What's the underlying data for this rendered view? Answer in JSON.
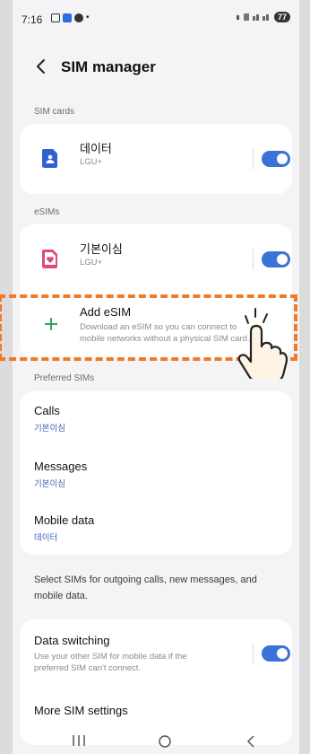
{
  "status": {
    "time": "7:16",
    "battery": "77"
  },
  "header": {
    "title": "SIM manager"
  },
  "sim_cards": {
    "label": "SIM cards",
    "item": {
      "name": "데이터",
      "carrier": "LGU+",
      "enabled": true
    }
  },
  "esims": {
    "label": "eSIMs",
    "item": {
      "name": "기본이심",
      "carrier": "LGU+",
      "enabled": true
    }
  },
  "add_esim": {
    "title": "Add eSIM",
    "desc_line1": "Download an eSIM so you can connect to",
    "desc_line2": "mobile networks without a physical SIM card."
  },
  "preferred": {
    "label": "Preferred SIMs",
    "items": [
      {
        "title": "Calls",
        "value": "기본이심"
      },
      {
        "title": "Messages",
        "value": "기본이심"
      },
      {
        "title": "Mobile data",
        "value": "데이터"
      }
    ]
  },
  "info": {
    "line1": "Select SIMs for outgoing calls, new messages, and",
    "line2": "mobile data."
  },
  "data_switching": {
    "title": "Data switching",
    "desc_line1": "Use your other SIM for mobile data if the",
    "desc_line2": "preferred SIM can't connect.",
    "enabled": true
  },
  "more": {
    "title": "More SIM settings"
  },
  "colors": {
    "accent": "#3a73d6",
    "highlight": "#ef7b2a"
  },
  "icons": [
    "back-icon",
    "sim-card-icon",
    "esim-icon",
    "plus-icon",
    "recents-icon",
    "home-icon",
    "back-nav-icon"
  ]
}
